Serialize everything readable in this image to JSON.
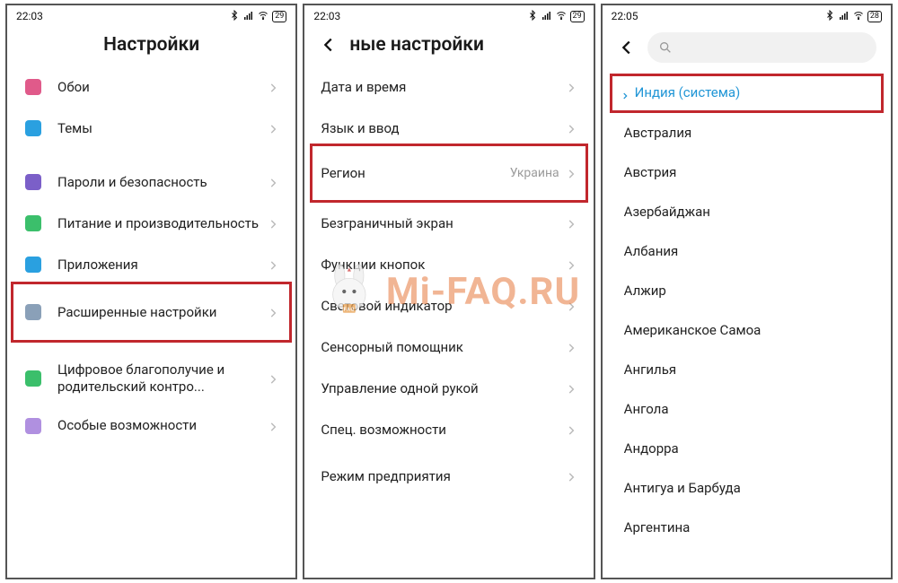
{
  "watermark": "Mi-FAQ.RU",
  "screens": {
    "s1": {
      "time": "22:03",
      "battery": "29",
      "title": "Настройки",
      "items": [
        {
          "label": "Обои",
          "icon": "wallpaper-icon",
          "color": "#e05a8a"
        },
        {
          "label": "Темы",
          "icon": "themes-icon",
          "color": "#2aa0e0"
        },
        {
          "gap": true
        },
        {
          "label": "Пароли и безопасность",
          "icon": "security-icon",
          "color": "#7b5fc8"
        },
        {
          "label": "Питание и производительность",
          "icon": "battery-icon",
          "color": "#3bbf6b"
        },
        {
          "label": "Приложения",
          "icon": "apps-icon",
          "color": "#2aa0e0"
        },
        {
          "label": "Расширенные настройки",
          "icon": "advanced-icon",
          "color": "#8aa0b8",
          "highlighted": true
        },
        {
          "gap": true
        },
        {
          "label": "Цифровое благополучие и родительский контро...",
          "icon": "wellbeing-icon",
          "color": "#3bbf6b"
        },
        {
          "label": "Особые возможности",
          "icon": "accessibility-icon",
          "color": "#b090e0"
        }
      ]
    },
    "s2": {
      "time": "22:03",
      "battery": "29",
      "title": "ные настройки",
      "items": [
        {
          "label": "Дата и время"
        },
        {
          "label": "Язык и ввод"
        },
        {
          "label": "Регион",
          "value": "Украина",
          "highlighted": true
        },
        {
          "gap": true,
          "small": true
        },
        {
          "label": "Безграничный экран"
        },
        {
          "label": "Функции кнопок"
        },
        {
          "label": "Световой индикатор"
        },
        {
          "label": "Сенсорный помощник"
        },
        {
          "label": "Управление одной рукой"
        },
        {
          "label": "Спец. возможности"
        },
        {
          "gap": true,
          "small": true
        },
        {
          "label": "Режим предприятия"
        }
      ]
    },
    "s3": {
      "time": "22:05",
      "battery": "28",
      "system_region": "Индия (система)",
      "regions": [
        "Австралия",
        "Австрия",
        "Азербайджан",
        "Албания",
        "Алжир",
        "Американское Самоа",
        "Ангилья",
        "Ангола",
        "Андорра",
        "Антигуа и Барбуда",
        "Аргентина"
      ]
    }
  }
}
